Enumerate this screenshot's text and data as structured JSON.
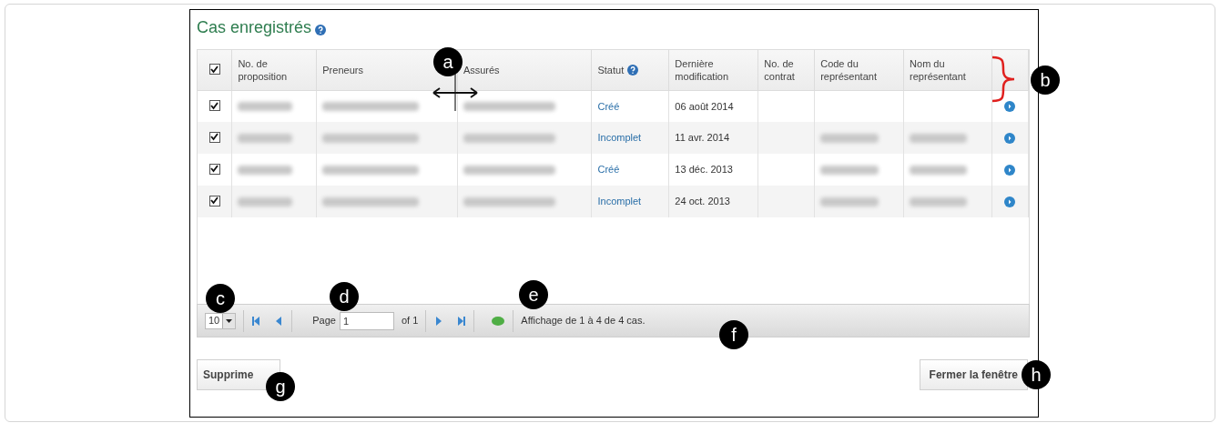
{
  "title": "Cas enregistrés",
  "select_all": {
    "checked": true
  },
  "columns": [
    {
      "label": "No. de proposition",
      "help": false
    },
    {
      "label": "Preneurs",
      "help": false
    },
    {
      "label": "Assurés",
      "help": false
    },
    {
      "label": "Statut",
      "help": true
    },
    {
      "label": "Dernière modification",
      "help": false
    },
    {
      "label": "No. de contrat",
      "help": false
    },
    {
      "label": "Code du représentant",
      "help": false
    },
    {
      "label": "Nom du représentant",
      "help": false
    },
    {
      "help": false
    }
  ],
  "rows": [
    {
      "checked": true,
      "cells": [
        {
          "kind": "redacted"
        },
        {
          "kind": "redacted"
        },
        {
          "kind": "redacted"
        },
        {
          "kind": "link",
          "text": "Créé"
        },
        {
          "kind": "text",
          "text": "06 août 2014"
        },
        {
          "kind": "empty"
        },
        {
          "kind": "empty"
        },
        {
          "kind": "empty"
        },
        {
          "kind": "action"
        }
      ]
    },
    {
      "checked": true,
      "cells": [
        {
          "kind": "redacted"
        },
        {
          "kind": "redacted"
        },
        {
          "kind": "redacted"
        },
        {
          "kind": "link",
          "text": "Incomplet"
        },
        {
          "kind": "text",
          "text": "11 avr. 2014"
        },
        {
          "kind": "empty"
        },
        {
          "kind": "redacted"
        },
        {
          "kind": "redacted"
        },
        {
          "kind": "action"
        }
      ]
    },
    {
      "checked": true,
      "cells": [
        {
          "kind": "redacted"
        },
        {
          "kind": "redacted"
        },
        {
          "kind": "redacted"
        },
        {
          "kind": "link",
          "text": "Créé"
        },
        {
          "kind": "text",
          "text": "13 déc. 2013"
        },
        {
          "kind": "empty"
        },
        {
          "kind": "redacted"
        },
        {
          "kind": "redacted"
        },
        {
          "kind": "action"
        }
      ]
    },
    {
      "checked": true,
      "cells": [
        {
          "kind": "redacted"
        },
        {
          "kind": "redacted"
        },
        {
          "kind": "redacted"
        },
        {
          "kind": "link",
          "text": "Incomplet"
        },
        {
          "kind": "text",
          "text": "24 oct. 2013"
        },
        {
          "kind": "empty"
        },
        {
          "kind": "redacted"
        },
        {
          "kind": "redacted"
        },
        {
          "kind": "action"
        }
      ]
    }
  ],
  "pager": {
    "page_size": "10",
    "page_label": "Page",
    "page": "1",
    "of": "of 1",
    "summary": "Affichage de 1 à 4 de 4 cas."
  },
  "buttons": {
    "delete": "Supprime",
    "close": "Fermer la fenêtre"
  },
  "callouts": [
    "a",
    "b",
    "c",
    "d",
    "e",
    "f",
    "g",
    "h"
  ]
}
